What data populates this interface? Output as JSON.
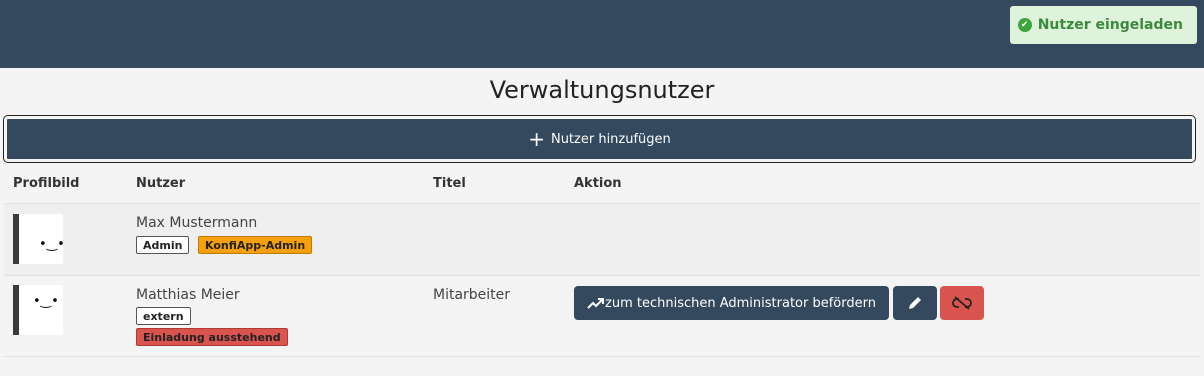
{
  "toast": {
    "message": "Nutzer eingeladen",
    "icon": "check-circle-icon",
    "color": "#3c8a3c"
  },
  "page": {
    "title": "Verwaltungsnutzer"
  },
  "add_button": {
    "label": "Nutzer hinzufügen",
    "icon": "plus-icon"
  },
  "table": {
    "headers": [
      "Profilbild",
      "Nutzer",
      "Titel",
      "Aktion"
    ],
    "rows": [
      {
        "name": "Max Mustermann",
        "title": "",
        "badges": [
          {
            "label": "Admin",
            "color": "#ffffff"
          },
          {
            "label": "KonfiApp-Admin",
            "color": "#f5a00c"
          }
        ],
        "actions": []
      },
      {
        "name": "Matthias Meier",
        "title": "Mitarbeiter",
        "badges": [
          {
            "label": "extern",
            "color": "#ffffff"
          },
          {
            "label": "Einladung ausstehend",
            "color": "#d9534f"
          }
        ],
        "actions": [
          {
            "label": "zum technischen Administrator befördern",
            "icon": "trending-up-icon"
          },
          {
            "label": "",
            "icon": "pencil-icon"
          },
          {
            "label": "",
            "icon": "unlink-icon"
          }
        ]
      }
    ]
  },
  "colors": {
    "primary": "#34495e",
    "danger": "#d9534f",
    "warning": "#f5a00c"
  }
}
